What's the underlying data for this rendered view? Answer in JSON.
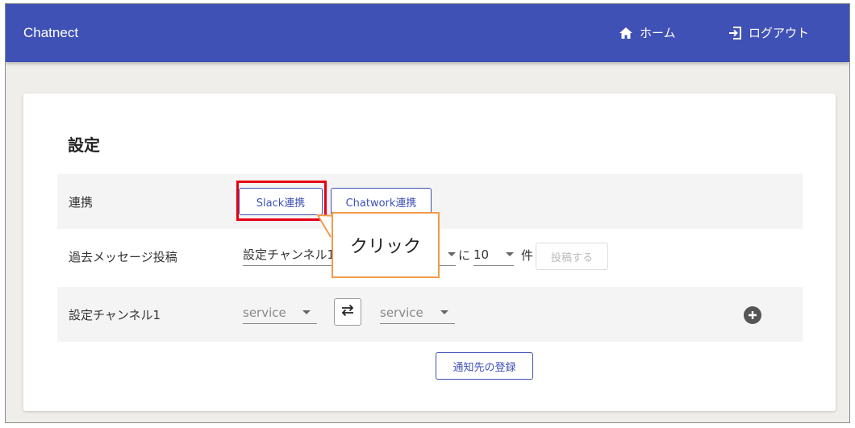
{
  "header": {
    "app_title": "Chatnect",
    "home_label": "ホーム",
    "logout_label": "ログアウト",
    "home_icon": "home-icon",
    "logout_icon": "logout-icon"
  },
  "page": {
    "title": "設定"
  },
  "rows": {
    "integration": {
      "label": "連携",
      "slack_button": "Slack連携",
      "chatwork_button": "Chatwork連携"
    },
    "past_messages": {
      "label": "過去メッセージ投稿",
      "channel_select": "設定チャンネル1",
      "to_text": "に",
      "count_select": "10",
      "unit_text": "件",
      "post_button": "投稿する"
    },
    "channel1": {
      "label": "設定チャンネル1",
      "source_service": "service",
      "target_service": "service",
      "swap_icon": "swap-arrows-icon",
      "add_icon": "plus-circle-icon"
    }
  },
  "register_button": "通知先の登録",
  "annotation": {
    "callout_text": "クリック"
  },
  "colors": {
    "primary": "#3f51b5",
    "highlight": "#e60012",
    "callout_border": "#f29a4a"
  }
}
